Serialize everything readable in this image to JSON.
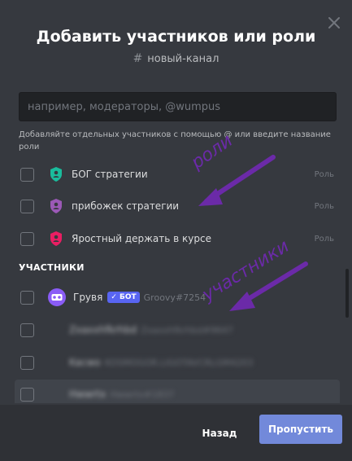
{
  "dialog": {
    "title": "Добавить участников или роли",
    "channel_hash": "#",
    "channel_name": "новый-канал"
  },
  "search": {
    "placeholder": "например, модераторы, @wumpus",
    "value": ""
  },
  "hint": "Добавляйте отдельных участников с помощью @ или введите название роли",
  "roles": [
    {
      "name": "БОГ стратегии",
      "tag": "Роль",
      "color": "#1abc9c",
      "icon": "shield-person-icon"
    },
    {
      "name": "прибожек стратегии",
      "tag": "Роль",
      "color": "#9b59b6",
      "icon": "shield-person-icon"
    },
    {
      "name": "Яростный держать в курсе",
      "tag": "Роль",
      "color": "#e91e63",
      "icon": "shield-person-icon"
    }
  ],
  "members_section": "УЧАСТНИКИ",
  "members": [
    {
      "name": "Грувя",
      "bot_label": "✓ БОТ",
      "tag": "Groovy#7254",
      "blurred": false
    },
    {
      "name": "Zxaxxhfkrhbd",
      "tag": "Zxaxxhfkrhbd#9647",
      "blurred": true
    },
    {
      "name": "Kacwo",
      "tag": "KOSMOGOR.LIGOTAVCRLGM4203",
      "blurred": true
    },
    {
      "name": "Hwwrtx",
      "tag": "Hwwrtx#1837",
      "blurred": true
    }
  ],
  "annotations": {
    "roles": "роли",
    "members": "участники",
    "color": "#6b2aa8"
  },
  "footer": {
    "back_label": "Назад",
    "skip_label": "Пропустить"
  },
  "colors": {
    "background": "#36393f",
    "footer": "#2f3136",
    "accent": "#7289da"
  }
}
